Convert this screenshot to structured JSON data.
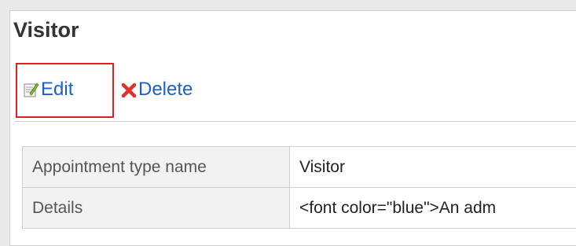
{
  "page": {
    "title": "Visitor"
  },
  "toolbar": {
    "edit_label": "Edit",
    "delete_label": "Delete"
  },
  "details": {
    "rows": [
      {
        "label": "Appointment type name",
        "value": "Visitor"
      },
      {
        "label": "Details",
        "value": "<font color=\"blue\">An adm"
      }
    ]
  },
  "colors": {
    "link": "#1a5fcc",
    "highlight_border": "#e02020",
    "delete_icon": "#e0312a",
    "label_bg": "#f2f2f2"
  },
  "icons": {
    "edit": "edit-icon",
    "delete": "delete-icon"
  }
}
